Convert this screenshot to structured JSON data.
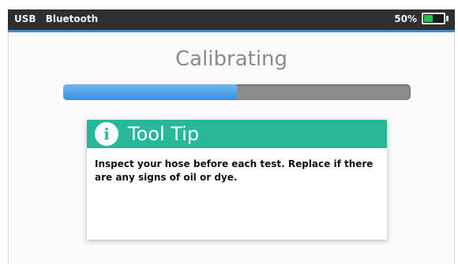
{
  "status_bar": {
    "usb_label": "USB",
    "bluetooth_label": "Bluetooth",
    "battery_percent_label": "50%",
    "battery_level": 0.5,
    "battery_color": "#21c44a"
  },
  "screen": {
    "title": "Calibrating",
    "progress": 0.5,
    "progress_color": "#3a90de"
  },
  "tooltip": {
    "icon": "info-icon",
    "title": "Tool Tip",
    "body": "Inspect your hose before each test.  Replace if there are any signs of oil or dye.",
    "header_color": "#27b79b"
  }
}
